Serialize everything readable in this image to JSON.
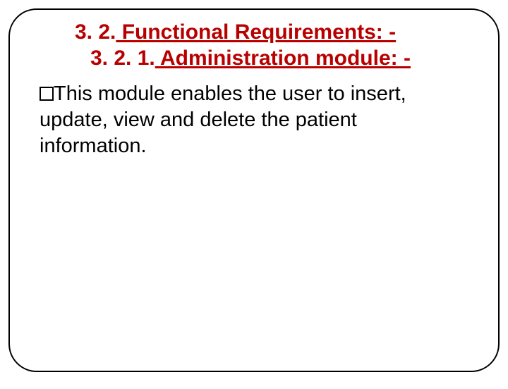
{
  "heading": {
    "line1_num": "3. 2.",
    "line1_title": " Functional Requirements: -",
    "line2_num": "3. 2. 1.",
    "line2_title": " Administration module: -"
  },
  "body": {
    "text": "This module enables the user to insert, update, view and delete the patient information."
  }
}
